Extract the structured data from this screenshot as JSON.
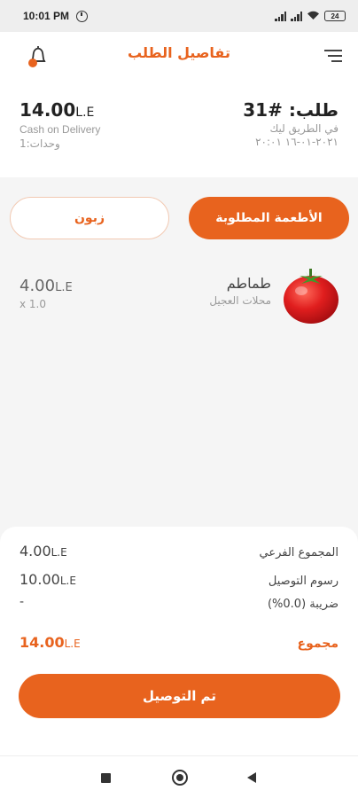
{
  "status_bar": {
    "time": "10:01 PM",
    "battery": "24",
    "icons": [
      "alarm-icon",
      "signal-icon",
      "signal-icon",
      "wifi-icon",
      "battery-icon"
    ]
  },
  "header": {
    "title": "تفاصيل الطلب",
    "left_icon": "bell-icon",
    "right_icon": "menu-icon",
    "accent_color": "#e8631e"
  },
  "order": {
    "number": "طلب: #31",
    "status": "في الطريق ليك",
    "date": "٢٠٢١-٠١-١٦ ٢٠:٠١",
    "total_amount": "14.00",
    "currency": "L.E",
    "payment_method": "Cash on Delivery",
    "units": "وحدات:1"
  },
  "tabs": [
    {
      "label": "الأطعمة المطلوبة",
      "active": true
    },
    {
      "label": "زبون",
      "active": false
    }
  ],
  "items": [
    {
      "name": "طماطم",
      "store": "محلات العجيل",
      "price": "4.00",
      "currency": "L.E",
      "quantity": "x 1.0",
      "image": "tomato-image"
    }
  ],
  "totals": {
    "subtotal_label": "المجموع الفرعي",
    "subtotal_value": "4.00",
    "delivery_label": "رسوم التوصيل",
    "delivery_value": "10.00",
    "tax_label": "ضريبة (0.0%)",
    "tax_value": "-",
    "total_label": "مجموع",
    "total_value": "14.00",
    "currency": "L.E"
  },
  "deliver_button": "تم التوصيل",
  "nav_bar": [
    "recents-icon",
    "home-icon",
    "back-icon"
  ]
}
